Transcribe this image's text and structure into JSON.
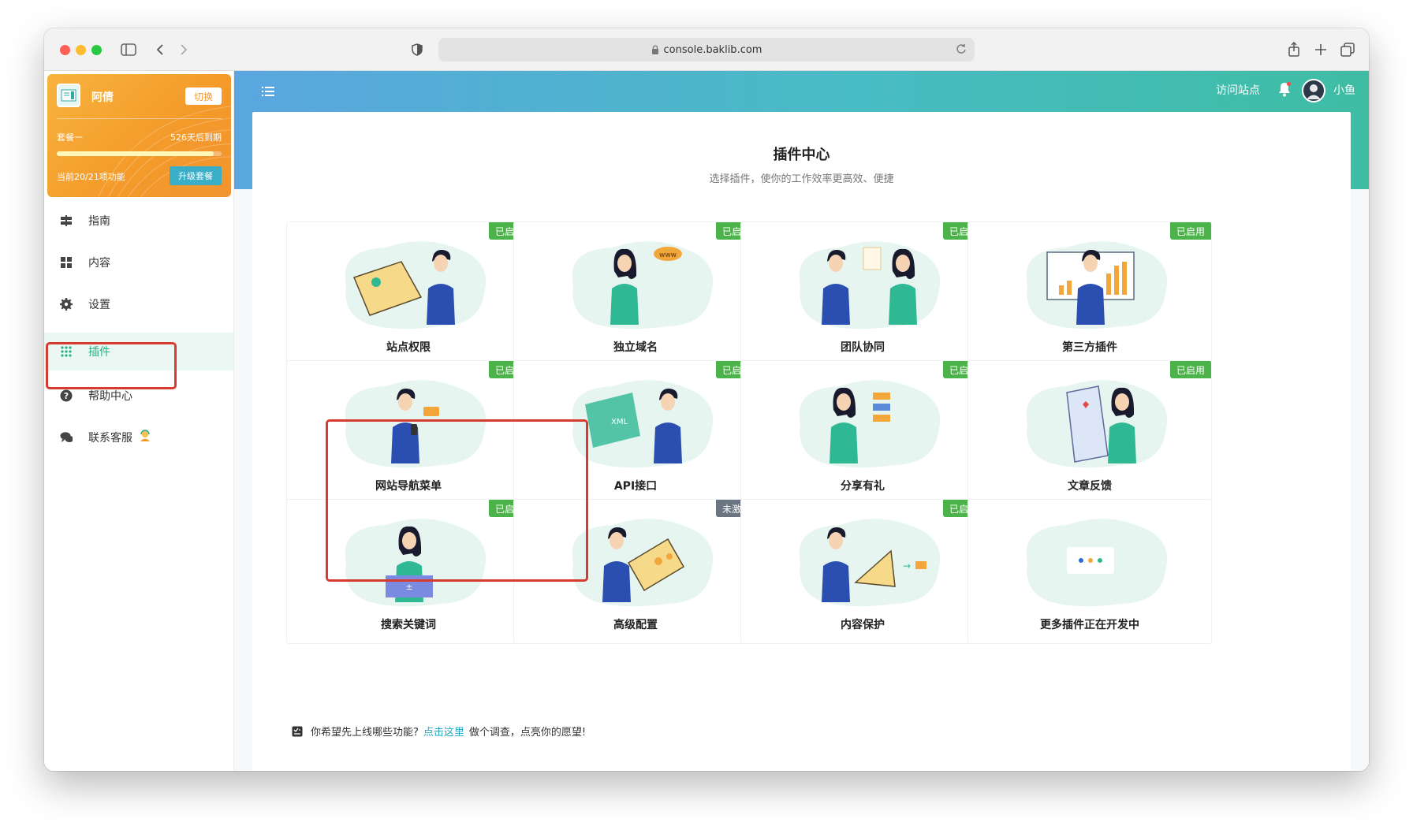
{
  "browser": {
    "url": "console.baklib.com"
  },
  "site": {
    "name": "阿倩",
    "switch_label": "切换",
    "plan": "套餐一",
    "expiry": "526天后到期",
    "features": "当前20/21项功能",
    "upgrade_label": "升级套餐",
    "progress_fraction": 0.95
  },
  "nav": [
    {
      "label": "指南",
      "icon": "signpost-icon"
    },
    {
      "label": "内容",
      "icon": "grid-icon"
    },
    {
      "label": "设置",
      "icon": "gear-icon"
    },
    {
      "label": "插件",
      "icon": "dots-grid-icon",
      "active": true
    },
    {
      "label": "帮助中心",
      "icon": "help-icon"
    },
    {
      "label": "联系客服",
      "icon": "chat-icon"
    }
  ],
  "header": {
    "visit_site": "访问站点",
    "user_name": "小鱼"
  },
  "plugin_center": {
    "title": "插件中心",
    "subtitle": "选择插件，使你的工作效率更高效、便捷",
    "plugins": [
      {
        "name": "站点权限",
        "status": "已启用"
      },
      {
        "name": "独立域名",
        "status": "已启用"
      },
      {
        "name": "团队协同",
        "status": "已启用"
      },
      {
        "name": "第三方插件",
        "status": "已启用"
      },
      {
        "name": "网站导航菜单",
        "status": "已启用"
      },
      {
        "name": "API接口",
        "status": "已启用"
      },
      {
        "name": "分享有礼",
        "status": "已启用"
      },
      {
        "name": "文章反馈",
        "status": "已启用"
      },
      {
        "name": "搜索关键词",
        "status": "已启用"
      },
      {
        "name": "高级配置",
        "status": "未激活"
      },
      {
        "name": "内容保护",
        "status": "已启用"
      },
      {
        "name": "更多插件正在开发中",
        "status": ""
      }
    ],
    "survey": {
      "prefix": "你希望先上线哪些功能?",
      "link": "点击这里",
      "suffix": "做个调查，点亮你的愿望!"
    }
  },
  "colors": {
    "accent": "#25b17e",
    "enabled_tag": "#4cb34a",
    "inactive_tag": "#6b7582",
    "highlight": "#d63b2f",
    "site_card": "#f39a2a"
  }
}
